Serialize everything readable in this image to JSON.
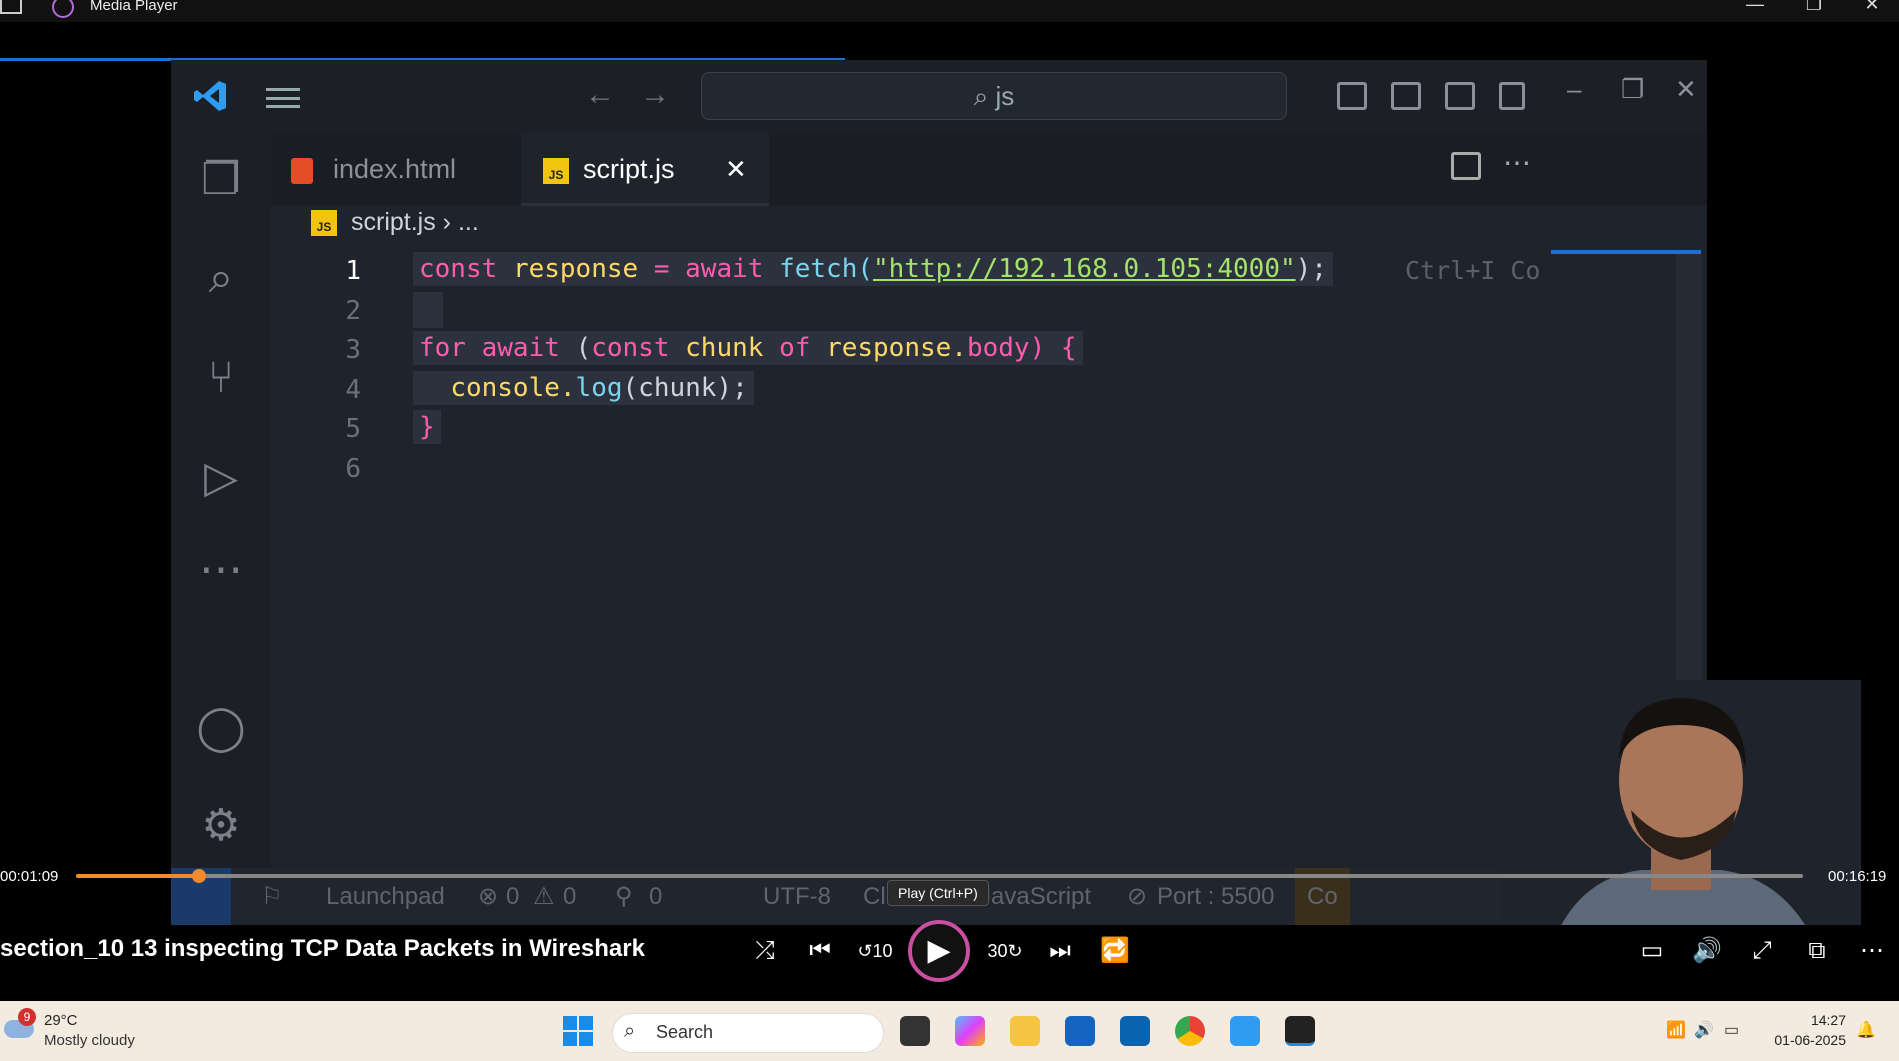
{
  "window": {
    "title": "Media Player",
    "minimize": "—",
    "maximize": "❐",
    "close": "✕"
  },
  "vscode": {
    "search_text": "js",
    "tabs": [
      {
        "label": "index.html"
      },
      {
        "label": "script.js"
      }
    ],
    "tab_close": "✕",
    "breadcrumb": {
      "file": "script.js",
      "more": "..."
    },
    "js_badge": "JS",
    "line_numbers": [
      "1",
      "2",
      "3",
      "4",
      "5",
      "6"
    ],
    "code": {
      "l1_kw": "const",
      "l1_id": "response",
      "l1_eq": "=",
      "l1_await": "await",
      "l1_fn": "fetch(",
      "l1_str": "\"http://192.168.0.105:4000\"",
      "l1_end": ");",
      "l3_for": "for",
      "l3_await": "await",
      "l3_paren": "(",
      "l3_const": "const",
      "l3_chunk": "chunk",
      "l3_of": "of",
      "l3_resp": "response.",
      "l3_body": "body",
      "l3_end": ") {",
      "l4_console": "console.",
      "l4_log": "log",
      "l4_arg": "(chunk);",
      "l5": "}"
    },
    "inline_hint": "Ctrl+I Co",
    "status": {
      "launchpad": "Launchpad",
      "errors": "0",
      "warnings": "0",
      "ports": "0",
      "encoding": "UTF-8",
      "eol": "Cl",
      "language": "JavaScript",
      "port": "Port : 5500",
      "extra": "Co"
    }
  },
  "player": {
    "elapsed": "00:01:09",
    "total": "00:16:19",
    "progress_fraction": 0.071,
    "tooltip": "Play (Ctrl+P)",
    "video_title": "section_10 13 inspecting TCP Data Packets in Wireshark"
  },
  "taskbar": {
    "weather_badge": "9",
    "temperature": "29°C",
    "condition": "Mostly cloudy",
    "search_placeholder": "Search",
    "time": "14:27",
    "date": "01-06-2025"
  },
  "colors": {
    "accent": "#f08a2c",
    "vscode_bg": "#1f232b",
    "taskbar_bg": "#f3ebe0"
  }
}
